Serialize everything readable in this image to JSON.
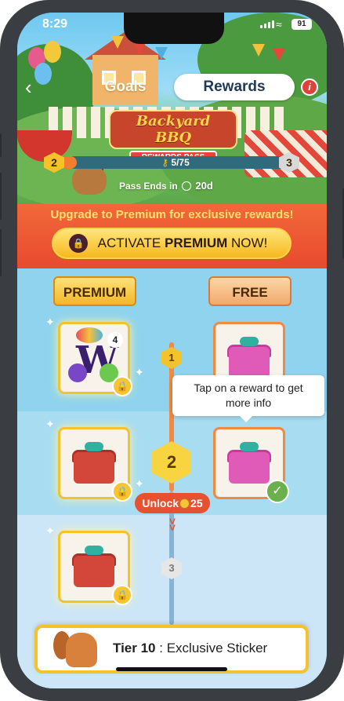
{
  "status_bar": {
    "time": "8:29",
    "battery": "91"
  },
  "tabs": {
    "goals": "Goals",
    "rewards": "Rewards"
  },
  "event": {
    "title": "Backyard BBQ",
    "subtitle": "REWARDS PASS",
    "current_tier": "2",
    "next_tier": "3",
    "progress_label": "5/75",
    "progress_fraction": 0.067,
    "pass_ends_label": "Pass Ends in",
    "pass_ends_value": "20d"
  },
  "upgrade": {
    "message": "Upgrade to Premium for exclusive rewards!",
    "button_prefix": "ACTIVATE",
    "button_bold": "PREMIUM",
    "button_suffix": "NOW!"
  },
  "columns": {
    "premium": "PREMIUM",
    "free": "FREE"
  },
  "tiers": [
    {
      "number": "1",
      "premium_reward": "word-pack-reward",
      "premium_count": "4",
      "premium_locked": true,
      "free_reward": "pink-chest",
      "free_claimed": true
    },
    {
      "number": "2",
      "premium_reward": "red-chest",
      "premium_locked": true,
      "free_reward": "pink-chest",
      "free_claimed": true
    },
    {
      "number": "3",
      "premium_reward": "red-chest",
      "premium_locked": true
    }
  ],
  "tooltip": {
    "line1": "Tap on a reward to get",
    "line2": "more info"
  },
  "unlock": {
    "label": "Unlock",
    "cost": "25"
  },
  "bottom_bar": {
    "tier": "Tier 10",
    "separator": ":",
    "reward": "Exclusive Sticker"
  },
  "colors": {
    "accent_orange": "#e8512f",
    "premium_gold": "#f4c229",
    "free_orange": "#f08a43",
    "track_blue": "#8fd3ee",
    "tab_text": "#1f3a55",
    "claimed_green": "#6ab04c"
  },
  "icons": {
    "back": "chevron-left-icon",
    "info": "info-icon",
    "lock": "lock-icon",
    "check": "checkmark-icon",
    "clock": "clock-icon",
    "coin": "coin-icon",
    "key": "key-icon"
  }
}
